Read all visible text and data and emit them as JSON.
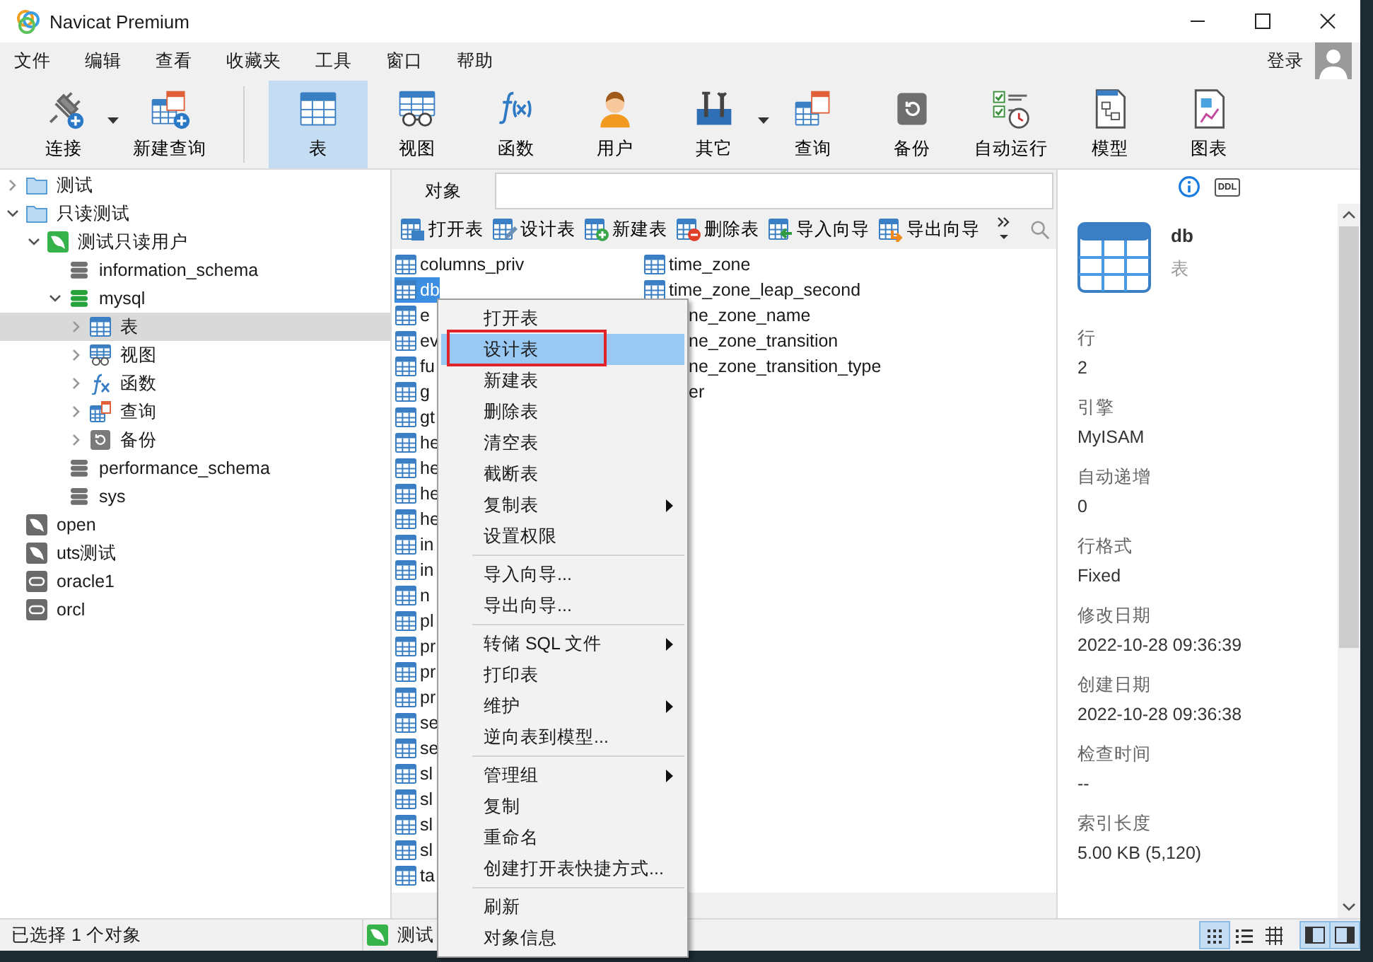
{
  "window": {
    "title": "Navicat Premium"
  },
  "menu": [
    "文件",
    "编辑",
    "查看",
    "收藏夹",
    "工具",
    "窗口",
    "帮助"
  ],
  "login": "登录",
  "toolbar": {
    "groups": [
      [
        {
          "label": "连接",
          "kind": "connect",
          "dropdown": true,
          "selected": false
        },
        {
          "label": "新建查询",
          "kind": "new_query",
          "dropdown": false,
          "selected": false
        }
      ],
      [
        {
          "label": "表",
          "kind": "table",
          "dropdown": false,
          "selected": true
        },
        {
          "label": "视图",
          "kind": "view",
          "dropdown": false,
          "selected": false
        },
        {
          "label": "函数",
          "kind": "function",
          "dropdown": false,
          "selected": false
        },
        {
          "label": "用户",
          "kind": "user",
          "dropdown": false,
          "selected": false
        },
        {
          "label": "其它",
          "kind": "other",
          "dropdown": true,
          "selected": false
        },
        {
          "label": "查询",
          "kind": "query",
          "dropdown": false,
          "selected": false
        },
        {
          "label": "备份",
          "kind": "backup",
          "dropdown": false,
          "selected": false
        },
        {
          "label": "自动运行",
          "kind": "auto_run",
          "dropdown": false,
          "selected": false
        },
        {
          "label": "模型",
          "kind": "model",
          "dropdown": false,
          "selected": false
        },
        {
          "label": "图表",
          "kind": "chart",
          "dropdown": false,
          "selected": false
        }
      ]
    ]
  },
  "tree": [
    {
      "label": "测试",
      "kind": "folder",
      "expanded": false,
      "selected": false
    },
    {
      "label": "只读测试",
      "kind": "folder",
      "expanded": true,
      "selected": false,
      "children": [
        {
          "label": "测试只读用户",
          "kind": "mysql_connected",
          "expanded": true,
          "selected": false,
          "children": [
            {
              "label": "information_schema",
              "kind": "database",
              "selected": false
            },
            {
              "label": "mysql",
              "kind": "database_open",
              "expanded": true,
              "selected": false,
              "children": [
                {
                  "label": "表",
                  "kind": "table",
                  "expanded": false,
                  "selected": true
                },
                {
                  "label": "视图",
                  "kind": "view",
                  "expanded": false,
                  "selected": false
                },
                {
                  "label": "函数",
                  "kind": "function",
                  "expanded": false,
                  "selected": false
                },
                {
                  "label": "查询",
                  "kind": "query",
                  "expanded": false,
                  "selected": false
                },
                {
                  "label": "备份",
                  "kind": "backup",
                  "expanded": false,
                  "selected": false
                }
              ]
            },
            {
              "label": "performance_schema",
              "kind": "database",
              "selected": false
            },
            {
              "label": "sys",
              "kind": "database",
              "selected": false
            }
          ]
        }
      ]
    },
    {
      "label": "open",
      "kind": "mysql",
      "selected": false
    },
    {
      "label": "uts测试",
      "kind": "mysql",
      "selected": false
    },
    {
      "label": "oracle1",
      "kind": "oracle",
      "selected": false
    },
    {
      "label": "orcl",
      "kind": "oracle",
      "selected": false
    }
  ],
  "object_tab": {
    "label": "对象",
    "selected": true
  },
  "object_toolbar": [
    {
      "label": "打开表",
      "kind": "open"
    },
    {
      "label": "设计表",
      "kind": "design"
    },
    {
      "label": "新建表",
      "kind": "new"
    },
    {
      "label": "删除表",
      "kind": "delete"
    },
    {
      "label": "导入向导",
      "kind": "import"
    },
    {
      "label": "导出向导",
      "kind": "export"
    }
  ],
  "objects": {
    "column_1": [
      {
        "name": "columns_priv",
        "selected": false
      },
      {
        "name": "db",
        "selected": true
      },
      {
        "name": "e",
        "selected": false
      },
      {
        "name": "ev",
        "selected": false
      },
      {
        "name": "fu",
        "selected": false
      },
      {
        "name": "g",
        "selected": false
      },
      {
        "name": "gt",
        "selected": false
      },
      {
        "name": "he",
        "selected": false
      },
      {
        "name": "he",
        "selected": false
      },
      {
        "name": "he",
        "selected": false
      },
      {
        "name": "he",
        "selected": false
      },
      {
        "name": "in",
        "selected": false
      },
      {
        "name": "in",
        "selected": false
      },
      {
        "name": "n",
        "selected": false
      },
      {
        "name": "pl",
        "selected": false
      },
      {
        "name": "pr",
        "selected": false
      },
      {
        "name": "pr",
        "selected": false
      },
      {
        "name": "pr",
        "selected": false
      },
      {
        "name": "se",
        "selected": false
      },
      {
        "name": "se",
        "selected": false
      },
      {
        "name": "sl",
        "selected": false
      },
      {
        "name": "sl",
        "selected": false
      },
      {
        "name": "sl",
        "selected": false
      },
      {
        "name": "sl",
        "selected": false
      },
      {
        "name": "ta",
        "selected": false
      }
    ],
    "column_2": [
      {
        "name": "time_zone",
        "covered": false
      },
      {
        "name": "time_zone_leap_second",
        "covered": false
      },
      {
        "name": "ne_zone_name",
        "covered": true
      },
      {
        "name": "ne_zone_transition",
        "covered": true
      },
      {
        "name": "ne_zone_transition_type",
        "covered": true
      },
      {
        "name": "er",
        "covered": true
      }
    ]
  },
  "context_menu": [
    {
      "label": "打开表",
      "selected": false,
      "outlined": false,
      "submenu": false,
      "separator_before": false
    },
    {
      "label": "设计表",
      "selected": true,
      "outlined": true,
      "submenu": false,
      "separator_before": false
    },
    {
      "label": "新建表",
      "selected": false,
      "outlined": false,
      "submenu": false,
      "separator_before": false
    },
    {
      "label": "删除表",
      "selected": false,
      "outlined": false,
      "submenu": false,
      "separator_before": false
    },
    {
      "label": "清空表",
      "selected": false,
      "outlined": false,
      "submenu": false,
      "separator_before": false
    },
    {
      "label": "截断表",
      "selected": false,
      "outlined": false,
      "submenu": false,
      "separator_before": false
    },
    {
      "label": "复制表",
      "selected": false,
      "outlined": false,
      "submenu": true,
      "separator_before": false
    },
    {
      "label": "设置权限",
      "selected": false,
      "outlined": false,
      "submenu": false,
      "separator_before": false
    },
    {
      "label": "导入向导...",
      "selected": false,
      "outlined": false,
      "submenu": false,
      "separator_before": true
    },
    {
      "label": "导出向导...",
      "selected": false,
      "outlined": false,
      "submenu": false,
      "separator_before": false
    },
    {
      "label": "转储 SQL 文件",
      "selected": false,
      "outlined": false,
      "submenu": true,
      "separator_before": true
    },
    {
      "label": "打印表",
      "selected": false,
      "outlined": false,
      "submenu": false,
      "separator_before": false
    },
    {
      "label": "维护",
      "selected": false,
      "outlined": false,
      "submenu": true,
      "separator_before": false
    },
    {
      "label": "逆向表到模型...",
      "selected": false,
      "outlined": false,
      "submenu": false,
      "separator_before": false
    },
    {
      "label": "管理组",
      "selected": false,
      "outlined": false,
      "submenu": true,
      "separator_before": true
    },
    {
      "label": "复制",
      "selected": false,
      "outlined": false,
      "submenu": false,
      "separator_before": false
    },
    {
      "label": "重命名",
      "selected": false,
      "outlined": false,
      "submenu": false,
      "separator_before": false
    },
    {
      "label": "创建打开表快捷方式...",
      "selected": false,
      "outlined": false,
      "submenu": false,
      "separator_before": false
    },
    {
      "label": "刷新",
      "selected": false,
      "outlined": false,
      "submenu": false,
      "separator_before": true
    },
    {
      "label": "对象信息",
      "selected": false,
      "outlined": false,
      "submenu": false,
      "separator_before": false
    }
  ],
  "info": {
    "tabs": [
      {
        "kind": "info",
        "selected": true
      },
      {
        "kind": "ddl",
        "label": "DDL",
        "selected": false
      }
    ],
    "name": "db",
    "type": "表",
    "properties": [
      {
        "label": "行",
        "value": "2"
      },
      {
        "label": "引擎",
        "value": "MyISAM"
      },
      {
        "label": "自动递增",
        "value": "0"
      },
      {
        "label": "行格式",
        "value": "Fixed"
      },
      {
        "label": "修改日期",
        "value": "2022-10-28 09:36:39"
      },
      {
        "label": "创建日期",
        "value": "2022-10-28 09:36:38"
      },
      {
        "label": "检查时间",
        "value": "--"
      },
      {
        "label": "索引长度",
        "value": "5.00 KB (5,120)"
      }
    ]
  },
  "status_bar": {
    "text": "已选择 1 个对象",
    "connection": "测试",
    "views": [
      {
        "kind": "icons",
        "selected": true
      },
      {
        "kind": "list",
        "selected": false
      },
      {
        "kind": "detail",
        "selected": false
      }
    ],
    "panes": [
      {
        "kind": "left",
        "selected": true
      },
      {
        "kind": "right",
        "selected": true
      }
    ]
  }
}
